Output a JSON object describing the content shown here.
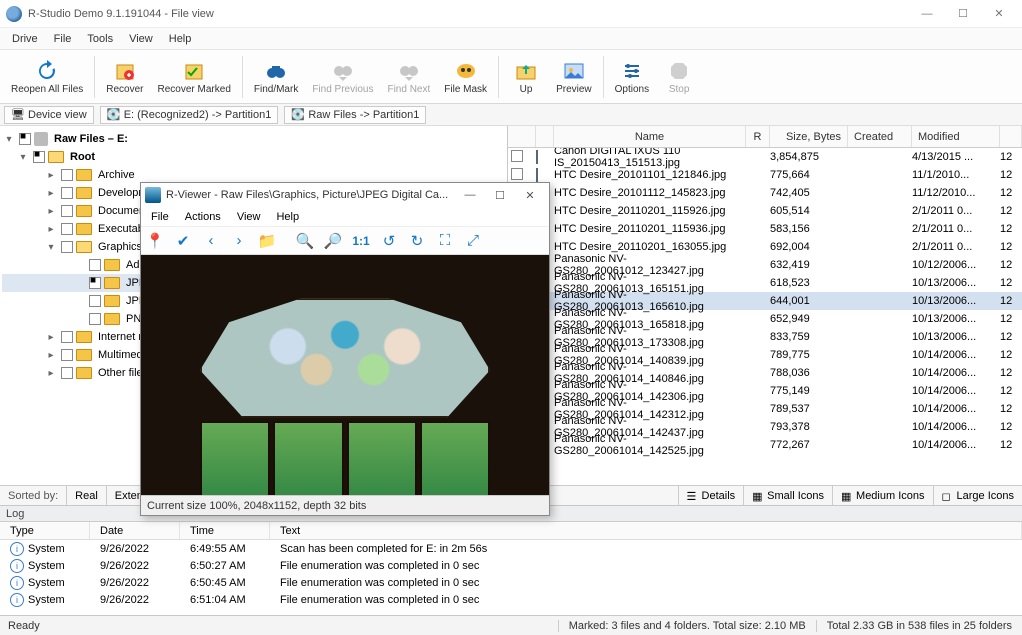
{
  "window": {
    "title": "R-Studio Demo 9.1.191044 - File view"
  },
  "menu": [
    "Drive",
    "File",
    "Tools",
    "View",
    "Help"
  ],
  "toolbar": [
    {
      "id": "reopen",
      "label": "Reopen All Files"
    },
    {
      "id": "recover",
      "label": "Recover"
    },
    {
      "id": "recmarked",
      "label": "Recover Marked"
    },
    {
      "id": "findmark",
      "label": "Find/Mark"
    },
    {
      "id": "findprev",
      "label": "Find Previous",
      "disabled": true
    },
    {
      "id": "findnext",
      "label": "Find Next",
      "disabled": true
    },
    {
      "id": "filemask",
      "label": "File Mask"
    },
    {
      "id": "up",
      "label": "Up"
    },
    {
      "id": "preview",
      "label": "Preview"
    },
    {
      "id": "options",
      "label": "Options"
    },
    {
      "id": "stop",
      "label": "Stop",
      "disabled": true
    }
  ],
  "breadcrumbs": {
    "deviceview": "Device view",
    "b1": "E: (Recognized2) -> Partition1",
    "b2": "Raw Files -> Partition1"
  },
  "tree": {
    "root": "Raw Files – E:",
    "rootnode": "Root",
    "folders": [
      "Archive",
      "Development files",
      "Document",
      "Executables",
      "Graphics,",
      "Internet re",
      "Multimedi",
      "Other files"
    ],
    "graphics_children": [
      "Adobe",
      "JPEG D",
      "JPEG Ir",
      "PNG Ir"
    ]
  },
  "grid": {
    "cols": {
      "name": "Name",
      "r": "R",
      "size": "Size, Bytes",
      "created": "Created",
      "modified": "Modified"
    },
    "rows": [
      {
        "name": "Canon DIGITAL IXUS 110 IS_20150413_151513.jpg",
        "size": "3,854,875",
        "mod": "4/13/2015 ...",
        "x": "12"
      },
      {
        "name": "HTC Desire_20101101_121846.jpg",
        "size": "775,664",
        "mod": "11/1/2010...",
        "x": "12"
      },
      {
        "name": "HTC Desire_20101112_145823.jpg",
        "size": "742,405",
        "mod": "11/12/2010...",
        "x": "12"
      },
      {
        "name": "HTC Desire_20110201_115926.jpg",
        "size": "605,514",
        "mod": "2/1/2011 0...",
        "x": "12"
      },
      {
        "name": "HTC Desire_20110201_115936.jpg",
        "size": "583,156",
        "mod": "2/1/2011 0...",
        "x": "12"
      },
      {
        "name": "HTC Desire_20110201_163055.jpg",
        "size": "692,004",
        "mod": "2/1/2011 0...",
        "x": "12"
      },
      {
        "name": "Panasonic NV-GS280_20061012_123427.jpg",
        "size": "632,419",
        "mod": "10/12/2006...",
        "x": "12"
      },
      {
        "name": "Panasonic NV-GS280_20061013_165151.jpg",
        "size": "618,523",
        "mod": "10/13/2006...",
        "x": "12"
      },
      {
        "name": "Panasonic NV-GS280_20061013_165610.jpg",
        "size": "644,001",
        "mod": "10/13/2006...",
        "x": "12",
        "sel": true
      },
      {
        "name": "Panasonic NV-GS280_20061013_165818.jpg",
        "size": "652,949",
        "mod": "10/13/2006...",
        "x": "12"
      },
      {
        "name": "Panasonic NV-GS280_20061013_173308.jpg",
        "size": "833,759",
        "mod": "10/13/2006...",
        "x": "12"
      },
      {
        "name": "Panasonic NV-GS280_20061014_140839.jpg",
        "size": "789,775",
        "mod": "10/14/2006...",
        "x": "12"
      },
      {
        "name": "Panasonic NV-GS280_20061014_140846.jpg",
        "size": "788,036",
        "mod": "10/14/2006...",
        "x": "12"
      },
      {
        "name": "Panasonic NV-GS280_20061014_142306.jpg",
        "size": "775,149",
        "mod": "10/14/2006...",
        "x": "12"
      },
      {
        "name": "Panasonic NV-GS280_20061014_142312.jpg",
        "size": "789,537",
        "mod": "10/14/2006...",
        "x": "12"
      },
      {
        "name": "Panasonic NV-GS280_20061014_142437.jpg",
        "size": "793,378",
        "mod": "10/14/2006...",
        "x": "12"
      },
      {
        "name": "Panasonic NV-GS280_20061014_142525.jpg",
        "size": "772,267",
        "mod": "10/14/2006...",
        "x": "12"
      }
    ]
  },
  "sortbar": {
    "sorted": "Sorted by:",
    "real": "Real",
    "ext": "Exten"
  },
  "viewbtns": {
    "details": "Details",
    "small": "Small Icons",
    "medium": "Medium Icons",
    "large": "Large Icons"
  },
  "log": {
    "title": "Log",
    "cols": {
      "type": "Type",
      "date": "Date",
      "time": "Time",
      "text": "Text"
    },
    "rows": [
      {
        "type": "System",
        "date": "9/26/2022",
        "time": "6:49:55 AM",
        "text": "Scan has been completed for E: in 2m 56s"
      },
      {
        "type": "System",
        "date": "9/26/2022",
        "time": "6:50:27 AM",
        "text": "File enumeration was completed in 0 sec"
      },
      {
        "type": "System",
        "date": "9/26/2022",
        "time": "6:50:45 AM",
        "text": "File enumeration was completed in 0 sec"
      },
      {
        "type": "System",
        "date": "9/26/2022",
        "time": "6:51:04 AM",
        "text": "File enumeration was completed in 0 sec"
      }
    ]
  },
  "status": {
    "ready": "Ready",
    "marked": "Marked: 3 files and 4 folders. Total size: 2.10 MB",
    "total": "Total 2.33 GB in 538 files in 25 folders"
  },
  "viewer": {
    "title": "R-Viewer - Raw Files\\Graphics, Picture\\JPEG Digital Ca...",
    "menu": [
      "File",
      "Actions",
      "View",
      "Help"
    ],
    "status": "Current size 100%, 2048x1152, depth 32 bits"
  }
}
